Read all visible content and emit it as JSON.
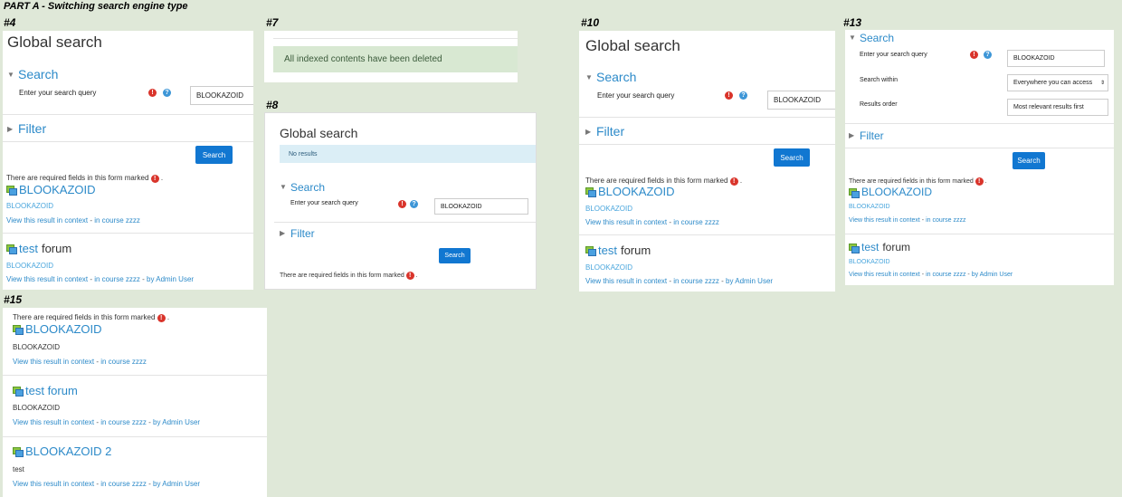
{
  "part_title": "PART A - Switching search engine type",
  "steps": {
    "s4": "#4",
    "s7": "#7",
    "s8": "#8",
    "s10": "#10",
    "s13": "#13",
    "s15": "#15"
  },
  "common": {
    "global_search": "Global search",
    "search_section": "Search",
    "filter_section": "Filter",
    "query_label": "Enter your search query",
    "query_value": "BLOOKAZOID",
    "search_button": "Search",
    "required_note": "There are required fields in this form marked",
    "view_context": "View this result in context",
    "sep": " - ",
    "in_course": "in course zzzz",
    "by_admin": "by Admin User",
    "req_glyph": "!",
    "help_glyph": "?",
    "period": "."
  },
  "p7": {
    "alert": "All indexed contents have been deleted"
  },
  "p8": {
    "no_results": "No results"
  },
  "p13": {
    "within_label": "Search within",
    "within_value": "Everywhere you can access",
    "order_label": "Results order",
    "order_value": "Most relevant results first"
  },
  "results": {
    "r1_title": "BLOOKAZOID",
    "r1_content": "BLOOKAZOID",
    "r2_title_a": "test",
    "r2_title_b": "forum",
    "r2_title": "test forum",
    "r2_content": "BLOOKAZOID",
    "r3_title": "BLOOKAZOID 2",
    "r3_content": "test"
  },
  "colors": {
    "accent": "#2c8ac9",
    "button": "#1177d1",
    "background": "#dfe8d8"
  }
}
